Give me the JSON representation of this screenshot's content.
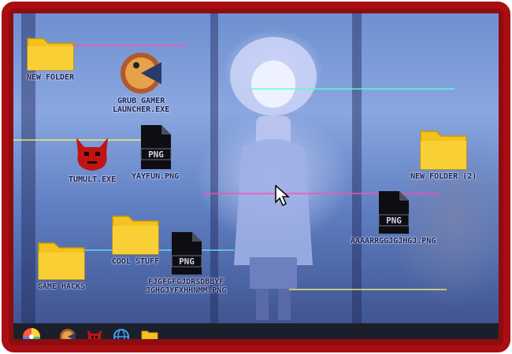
{
  "desktop": {
    "icons": [
      {
        "label": "NEW FOLDER",
        "icon": "folder-icon"
      },
      {
        "label": "GRUB GAMER\nLAUNCHER.EXE",
        "icon": "grub-launcher-icon"
      },
      {
        "label": "TUMULT.EXE",
        "icon": "demon-icon"
      },
      {
        "label": "YAYFUN.PNG",
        "icon": "png-file-icon"
      },
      {
        "label": "NEW FOLDER (2)",
        "icon": "folder-icon"
      },
      {
        "label": "AAAARRGGJGJHGJ.PNG",
        "icon": "png-file-icon"
      },
      {
        "label": "COOL STUFF",
        "icon": "folder-icon"
      },
      {
        "label": "GAME HACKS",
        "icon": "folder-icon"
      },
      {
        "label": "FJGFGFGJDRSDBBYF\nJGHGJYFXHHNMM.PNG",
        "icon": "png-file-icon"
      }
    ],
    "png_badge": "PNG"
  },
  "taskbar": {
    "items": [
      "start-color-wheel-icon",
      "grub-launcher-icon",
      "demon-icon",
      "globe-icon",
      "folder-icon"
    ]
  },
  "colors": {
    "frame": "#a80e12",
    "folder": "#f4c21c",
    "taskbar": "#1b1f2a"
  }
}
